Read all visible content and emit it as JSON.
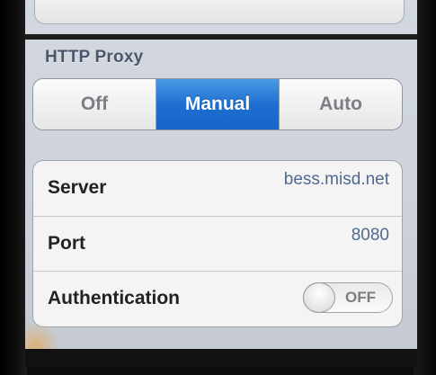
{
  "http_proxy": {
    "header": "HTTP Proxy",
    "modes": [
      {
        "label": "Off",
        "selected": false
      },
      {
        "label": "Manual",
        "selected": true
      },
      {
        "label": "Auto",
        "selected": false
      }
    ]
  },
  "fields": {
    "server": {
      "label": "Server",
      "value": "bess.misd.net"
    },
    "port": {
      "label": "Port",
      "value": "8080"
    },
    "authentication": {
      "label": "Authentication",
      "toggle_text": "OFF",
      "enabled": false
    }
  },
  "colors": {
    "selected_segment": "#1f6fd2",
    "value_text": "#51698f",
    "header_text": "#4c566a"
  }
}
